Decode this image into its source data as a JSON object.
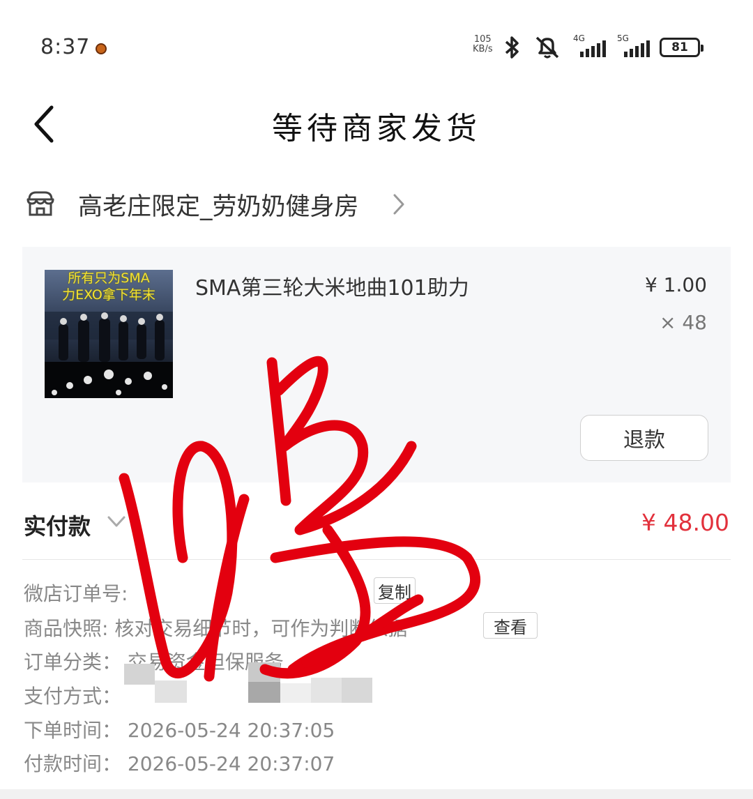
{
  "status_bar": {
    "time": "8:37",
    "net_speed_value": "105",
    "net_speed_unit": "KB/s",
    "signal_1_type": "4G",
    "signal_2_type": "5G",
    "battery": "81"
  },
  "header": {
    "title": "等待商家发货"
  },
  "shop": {
    "name": "高老庄限定_劳奶奶健身房"
  },
  "product": {
    "thumb_caption_line1": "所有只为SMA",
    "thumb_caption_line2": "力EXO拿下年末",
    "title": "SMA第三轮大米地曲101助力",
    "price": "¥ 1.00",
    "quantity": "× 48",
    "refund_label": "退款"
  },
  "payment": {
    "label": "实付款",
    "amount": "¥ 48.00"
  },
  "info": {
    "order_no_label": "微店订单号:",
    "copy_label": "复制",
    "snapshot_label": "商品快照:",
    "snapshot_value": "核对交易细节时，可作为判断依据",
    "view_label": "查看",
    "category_label": "订单分类：",
    "category_value": "交易资金担保服务",
    "pay_method_label": "支付方式：",
    "order_time_label": "下单时间：",
    "order_time_value": "2026-05-24 20:37:05",
    "pay_time_label": "付款时间：",
    "pay_time_value": "2026-05-24 20:37:07"
  },
  "colors": {
    "price_red": "#e2313c",
    "scribble_red": "#e3000f",
    "card_bg": "#f6f7f9"
  }
}
